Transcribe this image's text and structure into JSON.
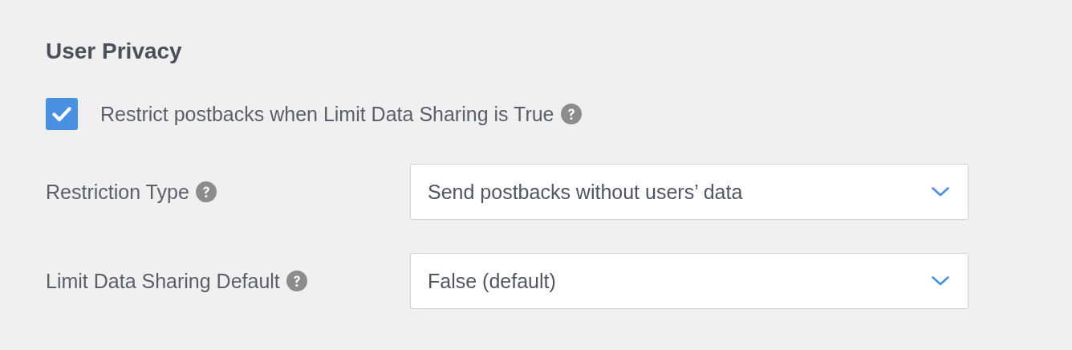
{
  "section": {
    "title": "User Privacy"
  },
  "checkbox": {
    "label": "Restrict postbacks when Limit Data Sharing is True",
    "checked": true,
    "help": true
  },
  "fields": [
    {
      "label": "Restriction Type",
      "help": true,
      "value": "Send postbacks without users’ data"
    },
    {
      "label": "Limit Data Sharing Default",
      "help": true,
      "value": "False (default)"
    }
  ]
}
